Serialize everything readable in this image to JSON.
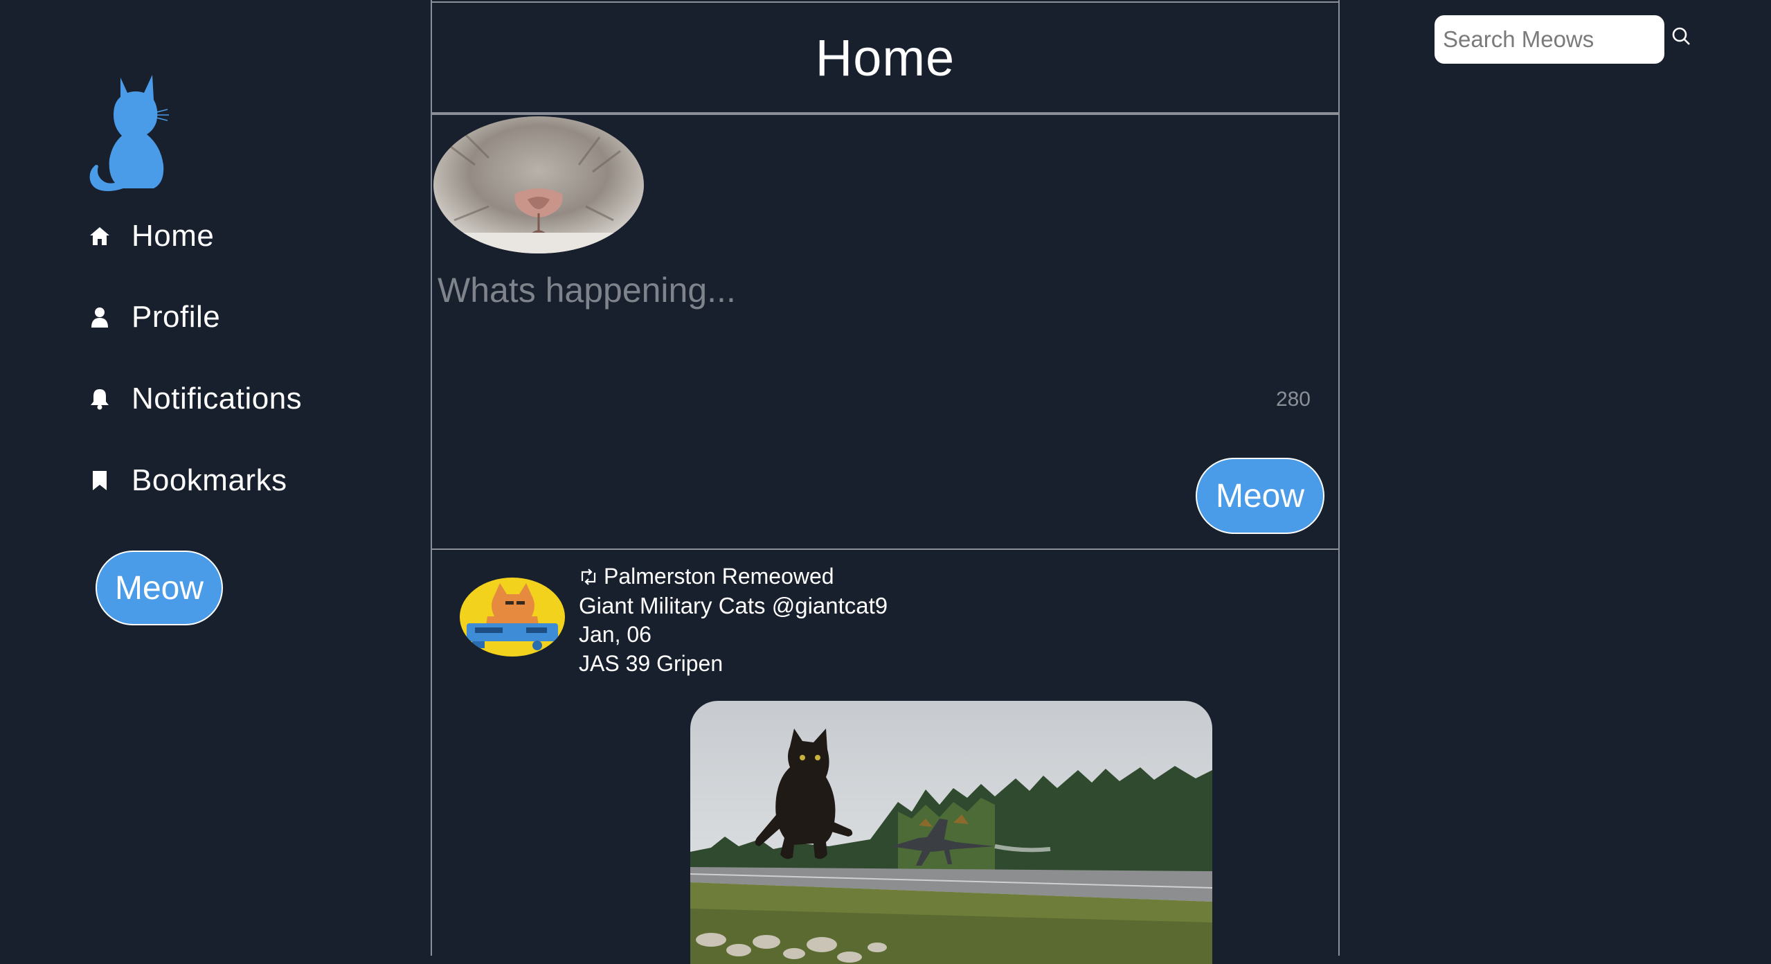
{
  "sidebar": {
    "logo": {
      "icon": "cat-silhouette-icon",
      "color": "#4a9be8"
    },
    "items": [
      {
        "label": "Home",
        "icon": "home-icon"
      },
      {
        "label": "Profile",
        "icon": "user-icon"
      },
      {
        "label": "Notifications",
        "icon": "bell-icon"
      },
      {
        "label": "Bookmarks",
        "icon": "bookmark-icon"
      }
    ],
    "meow_button": "Meow"
  },
  "feed": {
    "title": "Home",
    "composer": {
      "avatar": "cat-nose-avatar",
      "placeholder": "Whats happening...",
      "char_count": "280",
      "submit_label": "Meow"
    },
    "posts": [
      {
        "remeowed_by": "Palmerston Remeowed",
        "author": "Giant Military Cats @giantcat9",
        "date": "Jan, 06",
        "text": "JAS 39 Gripen",
        "avatar": "cat-with-gun-avatar",
        "image": "giant-cat-and-jet-on-runway"
      }
    ]
  },
  "search": {
    "placeholder": "Search Meows",
    "icon": "search-icon"
  },
  "colors": {
    "background": "#19202d",
    "accent": "#4a9be8",
    "border": "#8a8f98"
  }
}
